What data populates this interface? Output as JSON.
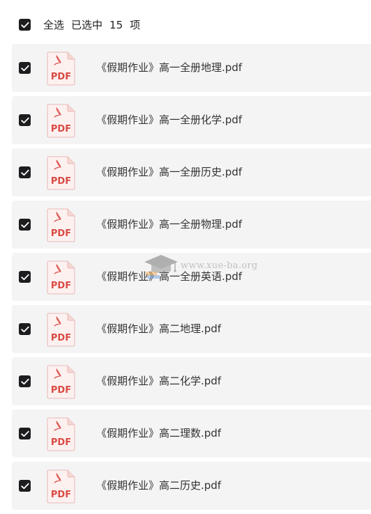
{
  "header": {
    "select_all_label": "全选",
    "selected_label": "已选中",
    "selected_count": "15",
    "unit_label": "项",
    "select_all_checked": true
  },
  "files": [
    {
      "name": "《假期作业》高一全册地理.pdf",
      "checked": true,
      "icon": "pdf-file-icon",
      "icon_label": "PDF"
    },
    {
      "name": "《假期作业》高一全册化学.pdf",
      "checked": true,
      "icon": "pdf-file-icon",
      "icon_label": "PDF"
    },
    {
      "name": "《假期作业》高一全册历史.pdf",
      "checked": true,
      "icon": "pdf-file-icon",
      "icon_label": "PDF"
    },
    {
      "name": "《假期作业》高一全册物理.pdf",
      "checked": true,
      "icon": "pdf-file-icon",
      "icon_label": "PDF"
    },
    {
      "name": "《假期作业》高一全册英语.pdf",
      "checked": true,
      "icon": "pdf-file-icon",
      "icon_label": "PDF"
    },
    {
      "name": "《假期作业》高二地理.pdf",
      "checked": true,
      "icon": "pdf-file-icon",
      "icon_label": "PDF"
    },
    {
      "name": "《假期作业》高二化学.pdf",
      "checked": true,
      "icon": "pdf-file-icon",
      "icon_label": "PDF"
    },
    {
      "name": "《假期作业》高二理数.pdf",
      "checked": true,
      "icon": "pdf-file-icon",
      "icon_label": "PDF"
    },
    {
      "name": "《假期作业》高二历史.pdf",
      "checked": true,
      "icon": "pdf-file-icon",
      "icon_label": "PDF"
    }
  ],
  "watermark": {
    "text": "www.xue-ba.org",
    "icon": "graduation-cap-icon"
  },
  "colors": {
    "checkbox": "#1d1d1f",
    "row_background": "#f4f4f5",
    "pdf_red": "#d94a43",
    "pdf_icon_bg": "#fdf1f0"
  }
}
